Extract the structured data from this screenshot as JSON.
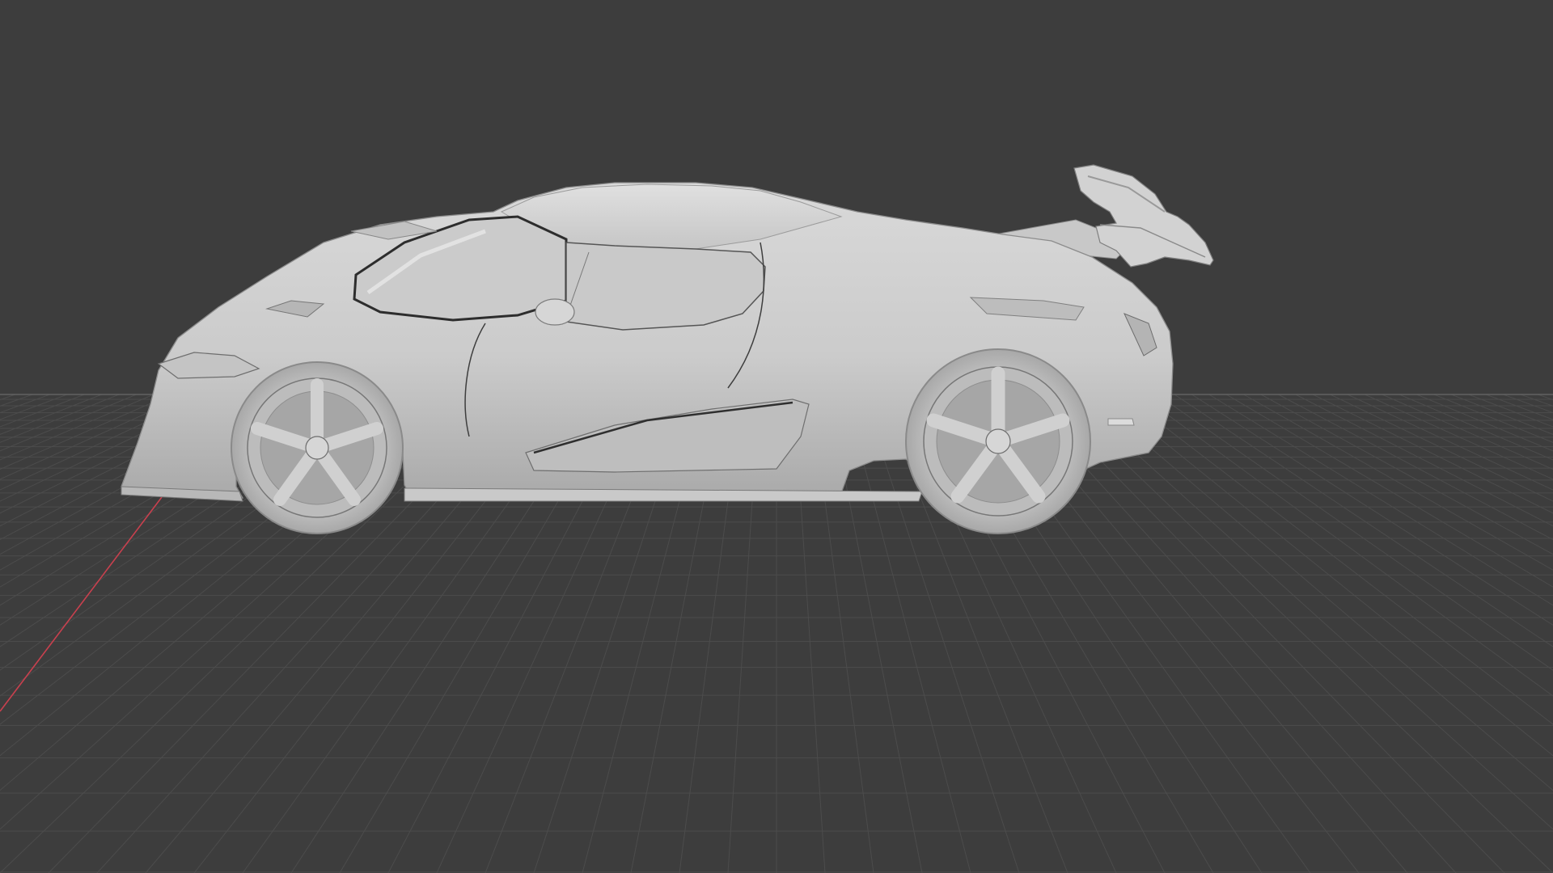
{
  "viewport": {
    "mode": "3d-viewport",
    "shading": "solid",
    "background_color": "#3d3d3d",
    "grid_color": "#4c4c4c",
    "x_axis_color": "#c8404e",
    "horizon_line_color": "#6a6a6a",
    "model": {
      "name_icon": "car-model",
      "material_color": "#cfcfcf",
      "shadow_color": "#9e9e9e",
      "highlight_color": "#e2e2e2",
      "line_color": "#2a2a2a"
    }
  }
}
